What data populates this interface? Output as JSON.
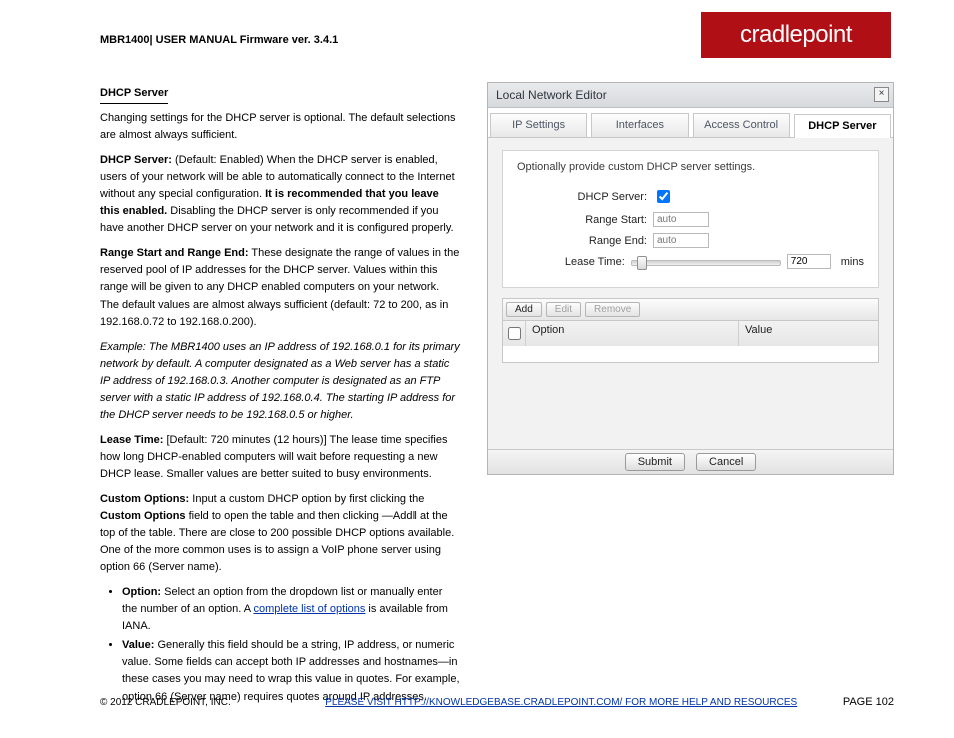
{
  "header": {
    "manual_header": "MBR1400| USER MANUAL Firmware ver. 3.4.1",
    "logo_text": "cradlepoint"
  },
  "left": {
    "section_head": "DHCP Server",
    "section_intro": "Changing settings for the DHCP server is optional. The default selections are almost always sufficient.",
    "dhcp_server_label": "DHCP Server:",
    "dhcp_server_text": " (Default: Enabled) When the DHCP server is enabled, users of your network will be able to automatically connect to the Internet without any special configuration. ",
    "dhcp_server_bold_tail": "It is recommended that you leave this enabled.",
    "dhcp_server_tail": " Disabling the DHCP server is only recommended if you have another DHCP server on your network and it is configured properly.",
    "range_start_end_label": "Range Start and Range End:",
    "range_text": " These designate the range of values in the reserved pool of IP addresses for the DHCP server. Values within this range will be given to any DHCP enabled computers on your network. The default values are almost always sufficient (default: 72 to 200, as in 192.168.0.72 to 192.168.0.200).",
    "example_head": "Example:",
    "example_text": " The MBR1400 uses an IP address of 192.168.0.1 for its primary network by default. A computer designated as a Web server has a static IP address of 192.168.0.3. Another computer is designated as an FTP server with a static IP address of 192.168.0.4. The starting IP address for the DHCP server needs to be 192.168.0.5 or higher.",
    "lease_time_label": "Lease Time:",
    "lease_time_text": " [Default: 720 minutes (12 hours)] The lease time specifies how long DHCP-enabled computers will wait before requesting a new DHCP lease. Smaller values are better suited to busy environments.",
    "custom_options_label": "Custom Options:",
    "custom_options_text_a": " Input a custom DHCP option by first clicking the ",
    "custom_options_bold_mid": "Custom Options",
    "custom_options_text_b": " field to open the table and then clicking ―Add‖ at the top of the table. There are close to 200 possible DHCP options available. One of the more common uses is to assign a VoIP phone server using option 66 (Server name).",
    "bullets": [
      {
        "label": "Option:",
        "text": " Select an option from the dropdown list or manually enter the number of an option. A ",
        "link_text": "complete list of options",
        "tail": " is available from IANA."
      },
      {
        "label": "Value:",
        "text": " Generally this field should be a string, IP address, or numeric value. Some fields can accept both IP addresses and hostnames—in these cases you may need to wrap this value in quotes. For example, option 66 (Server name) requires quotes around IP addresses."
      }
    ]
  },
  "dialog": {
    "title": "Local Network Editor",
    "tabs": [
      "IP Settings",
      "Interfaces",
      "Access Control",
      "DHCP Server"
    ],
    "active_tab_index": 3,
    "instruction": "Optionally provide custom DHCP server settings.",
    "rows": {
      "dhcp_server_label": "DHCP Server:",
      "range_start_label": "Range Start:",
      "range_start_value": "auto",
      "range_end_label": "Range End:",
      "range_end_value": "auto",
      "lease_time_label": "Lease Time:",
      "lease_time_value": "720",
      "mins_label": "mins"
    },
    "toolbar": {
      "add": "Add",
      "edit": "Edit",
      "remove": "Remove"
    },
    "columns": {
      "option": "Option",
      "value": "Value"
    },
    "footer": {
      "submit": "Submit",
      "cancel": "Cancel"
    }
  },
  "footer": {
    "copyright_text": "© 2012 CRADLEPOINT, INC.",
    "copyright_pad": "                                  ",
    "copyright_link": "PLEASE VISIT HTTP://KNOWLEDGEBASE.CRADLEPOINT.COM/ FOR MORE HELP AND RESOURCES",
    "page_prefix": "PAGE ",
    "page_num": "102"
  }
}
